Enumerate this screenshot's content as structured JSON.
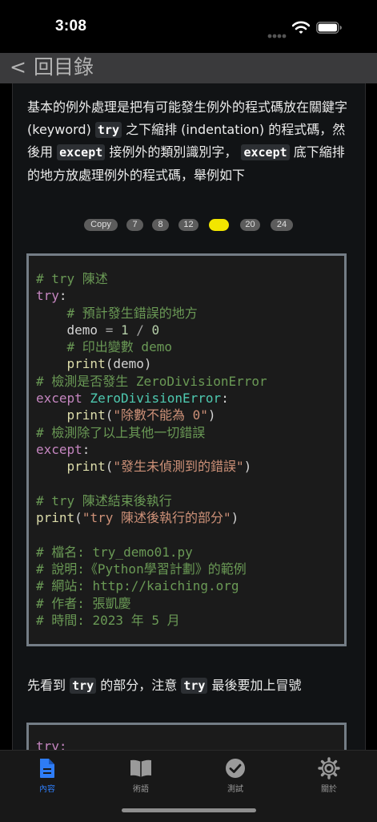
{
  "status": {
    "time": "3:08"
  },
  "nav": {
    "back_label": "回目錄"
  },
  "intro": {
    "t1": "基本的例外處理是把有可能發生例外的程式碼放在關鍵字 (keyword) ",
    "k1": "try",
    "t2": " 之下縮排 (indentation) 的程式碼，然後用 ",
    "k2": "except",
    "t3": " 接例外的類別識別字， ",
    "k3": "except",
    "t4": " 底下縮排的地方放處理例外的程式碼，舉例如下"
  },
  "toolbar": {
    "copy": "Copy",
    "sizes": [
      "7",
      "8",
      "12",
      "16",
      "20",
      "24"
    ],
    "active_size": "16"
  },
  "code": {
    "l1": "# try 陳述",
    "l2_kw": "try",
    "l2_rest": ":",
    "l3": "    # 預計發生錯誤的地方",
    "l4_var": "    demo ",
    "l4_op1": "=",
    "l4_n1": " 1",
    "l4_op2": " /",
    "l4_n2": " 0",
    "l5": "    # 印出變數 demo",
    "l6_fn": "    print",
    "l6_rest": "(demo)",
    "l7": "# 檢測是否發生 ZeroDivisionError",
    "l8_kw": "except",
    "l8_cls": " ZeroDivisionError",
    "l8_rest": ":",
    "l9_fn": "    print",
    "l9_p1": "(",
    "l9_str": "\"除數不能為 0\"",
    "l9_p2": ")",
    "l10": "# 檢測除了以上其他一切錯誤",
    "l11_kw": "except",
    "l11_rest": ":",
    "l12_fn": "    print",
    "l12_p1": "(",
    "l12_str": "\"發生未偵測到的錯誤\"",
    "l12_p2": ")",
    "l13": "# try 陳述結束後執行",
    "l14_fn": "print",
    "l14_p1": "(",
    "l14_str": "\"try 陳述後執行的部分\"",
    "l14_p2": ")",
    "l15": "# 檔名: try_demo01.py",
    "l16": "# 說明:《Python學習計劃》的範例",
    "l17": "# 網站: http://kaiching.org",
    "l18": "# 作者: 張凱慶",
    "l19": "# 時間: 2023 年 5 月"
  },
  "para2": {
    "t1": "先看到 ",
    "k1": "try",
    "t2": " 的部分，注意 ",
    "k2": "try",
    "t3": " 最後要加上冒號"
  },
  "code2": {
    "l1": "try:"
  },
  "tabs": [
    {
      "label": "內容",
      "icon": "document-icon",
      "active": true
    },
    {
      "label": "術語",
      "icon": "book-icon",
      "active": false
    },
    {
      "label": "測試",
      "icon": "checkmark-circle-icon",
      "active": false
    },
    {
      "label": "關於",
      "icon": "gear-icon",
      "active": false
    }
  ],
  "colors": {
    "accent": "#2e7cf6",
    "active_pill": "#f2e600",
    "comment": "#6a9955",
    "keyword": "#c586c0",
    "class": "#4ec9b0",
    "string": "#ce9178"
  }
}
